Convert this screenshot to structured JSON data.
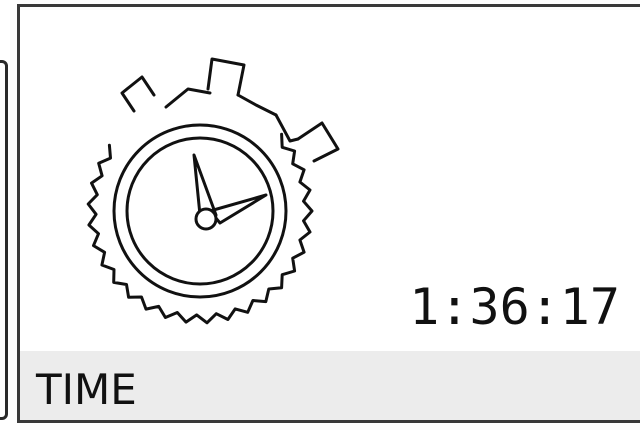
{
  "widget": {
    "icon": "stopwatch-icon",
    "time_value": "1:36:17",
    "label": "TIME"
  }
}
